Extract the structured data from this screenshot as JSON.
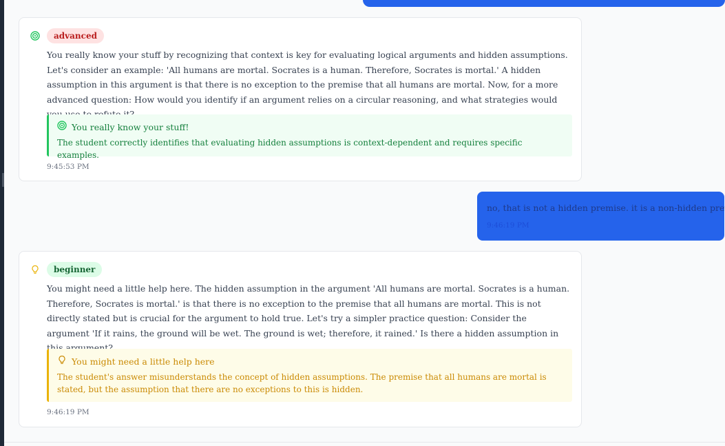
{
  "messages": [
    {
      "role": "assistant",
      "level_icon": "target-icon",
      "level": "advanced",
      "text": "You really know your stuff by recognizing that context is key for evaluating logical arguments and hidden assumptions. Let's consider an example: 'All humans are mortal. Socrates is a human. Therefore, Socrates is mortal.' A hidden assumption in this argument is that there is no exception to the premise that all humans are mortal. Now, for a more advanced question: How would you identify if an argument relies on a circular reasoning, and what strategies would you use to refute it?",
      "feedback": {
        "icon": "target-icon",
        "title": "You really know your stuff!",
        "body": "The student correctly identifies that evaluating hidden assumptions is context-dependent and requires specific examples."
      },
      "time": "9:45:53 PM"
    },
    {
      "role": "user",
      "text": "no, that is not a hidden premise. it is a non-hidden premise.",
      "time": "9:46:19 PM"
    },
    {
      "role": "assistant",
      "level_icon": "lightbulb-icon",
      "level": "beginner",
      "text": "You might need a little help here. The hidden assumption in the argument 'All humans are mortal. Socrates is a human. Therefore, Socrates is mortal.' is that there is no exception to the premise that all humans are mortal. This is not directly stated but is crucial for the argument to hold true. Let's try a simpler practice question: Consider the argument 'If it rains, the ground will be wet. The ground is wet; therefore, it rained.' Is there a hidden assumption in this argument?",
      "feedback": {
        "icon": "lightbulb-icon",
        "title": "You might need a little help here",
        "body": "The student's answer misunderstands the concept of hidden assumptions. The premise that all humans are mortal is stated, but the assumption that there are no exceptions to this is hidden."
      },
      "time": "9:46:19 PM"
    }
  ],
  "colors": {
    "user_bubble": "#2563eb",
    "advanced_badge_bg": "#fee2e2",
    "advanced_badge_text": "#b91c1c",
    "beginner_badge_bg": "#dcfce7",
    "beginner_badge_text": "#166534",
    "feedback_good": "#22c55e",
    "feedback_help": "#eab308"
  }
}
